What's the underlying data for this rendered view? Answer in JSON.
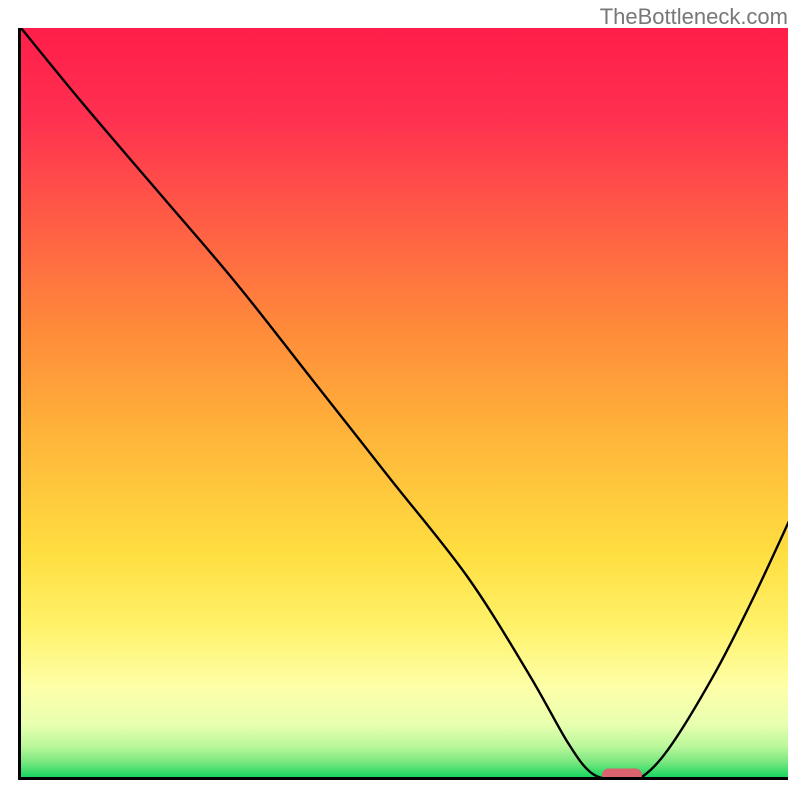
{
  "watermark": "TheBottleneck.com",
  "chart_data": {
    "type": "line",
    "title": "",
    "xlabel": "",
    "ylabel": "",
    "xlim": [
      0,
      100
    ],
    "ylim": [
      0,
      100
    ],
    "series": [
      {
        "name": "bottleneck-curve",
        "x": [
          0,
          8,
          18,
          28,
          38,
          48,
          58,
          66,
          71,
          74,
          77,
          80,
          84,
          90,
          95,
          100
        ],
        "y": [
          100,
          90,
          78,
          66,
          53,
          40,
          27,
          14,
          5,
          1,
          0,
          0,
          4,
          14,
          24,
          35
        ]
      }
    ],
    "marker": {
      "x": 78,
      "y": 0.6
    },
    "gradient_stops": [
      {
        "pct": 0,
        "color": "#ff1e4a"
      },
      {
        "pct": 12,
        "color": "#ff3050"
      },
      {
        "pct": 25,
        "color": "#ff5a46"
      },
      {
        "pct": 40,
        "color": "#ff8a3a"
      },
      {
        "pct": 55,
        "color": "#ffb63a"
      },
      {
        "pct": 70,
        "color": "#ffde40"
      },
      {
        "pct": 80,
        "color": "#fff26a"
      },
      {
        "pct": 88,
        "color": "#feffa8"
      },
      {
        "pct": 93,
        "color": "#e8ffb0"
      },
      {
        "pct": 96,
        "color": "#b8f79a"
      },
      {
        "pct": 98,
        "color": "#7ae87f"
      },
      {
        "pct": 100,
        "color": "#18d65f"
      }
    ]
  }
}
